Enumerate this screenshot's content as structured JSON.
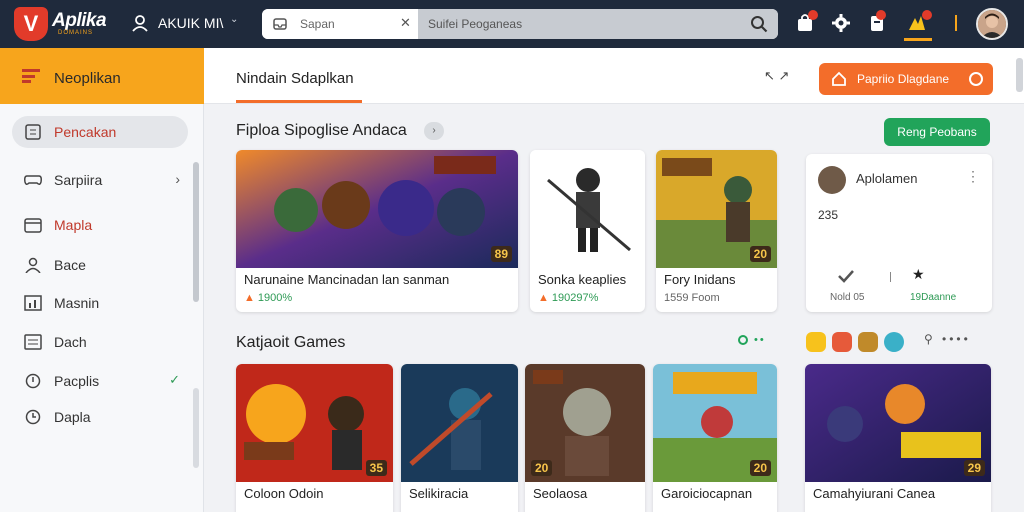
{
  "topbar": {
    "brand": "Aplika",
    "brand_sub": "DOMAINS",
    "user_name": "AKUIK MI\\",
    "search_placeholder": "Sapan",
    "search_value": "Suifei Peoganeas"
  },
  "sidebar": {
    "header": "Neoplikan",
    "items": [
      {
        "label": "Pencakan",
        "icon": "document-icon"
      },
      {
        "label": "Sarpiira",
        "icon": "gamepad-icon"
      },
      {
        "label": "Mapla",
        "icon": "calendar-icon"
      },
      {
        "label": "Bace",
        "icon": "user-icon"
      },
      {
        "label": "Masnin",
        "icon": "chart-icon"
      },
      {
        "label": "Dach",
        "icon": "list-icon"
      },
      {
        "label": "Pacplis",
        "icon": "shield-icon"
      },
      {
        "label": "Dapla",
        "icon": "clock-icon"
      }
    ]
  },
  "main": {
    "tab": "Nindain  Sdaplkan",
    "share_label": "↖ ↗",
    "cta": "Papriio Dlagdane",
    "section1": {
      "title": "Fiploa Sipoglise Andaca",
      "button": "Reng Peobans"
    },
    "section2": {
      "title": "Katjaoit Games"
    },
    "row1": [
      {
        "title": "Narunaine Mancinadan lan sanman",
        "meta": "1900%",
        "tag": "89"
      },
      {
        "title": "Sonka keaplies",
        "meta": "190297%",
        "tag": ""
      },
      {
        "title": "Fory Inidans",
        "meta": "1559 Foom",
        "tag": "20"
      }
    ],
    "side_card": {
      "name": "Aplolamen",
      "count": "235",
      "stat1": "Nold 05",
      "stat2": "19Daanne"
    },
    "row2": [
      {
        "title": "Coloon Odoin",
        "tag": "35"
      },
      {
        "title": "Selikiracia",
        "tag": ""
      },
      {
        "title": "Seolaosa",
        "tag": "20"
      },
      {
        "title": "Garoiciocapnan",
        "tag": "20"
      },
      {
        "title": "Camahyiurani Canea",
        "tag": "29"
      }
    ]
  },
  "colors": {
    "accent_orange": "#f36d2a",
    "sidebar_header": "#f7a51c",
    "topbar": "#1f2a3c",
    "green": "#21a45a"
  }
}
